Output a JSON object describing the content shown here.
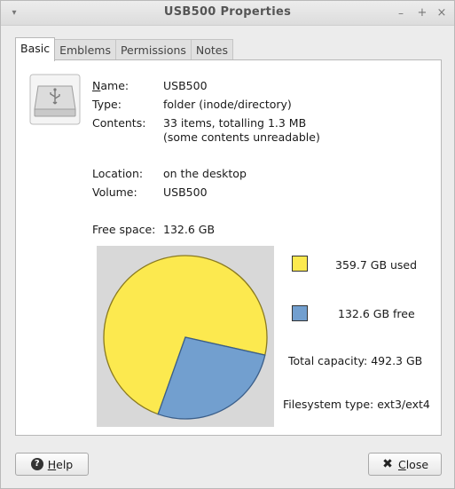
{
  "window": {
    "title": "USB500 Properties",
    "menu_icon": "chevron-down-icon",
    "minimize_glyph": "–",
    "maximize_glyph": "+",
    "close_glyph": "×"
  },
  "tabs": [
    {
      "label": "Basic",
      "active": true
    },
    {
      "label": "Emblems",
      "active": false
    },
    {
      "label": "Permissions",
      "active": false
    },
    {
      "label": "Notes",
      "active": false
    }
  ],
  "info": {
    "name_label": "Name:",
    "name_value": "USB500",
    "type_label": "Type:",
    "type_value": "folder (inode/directory)",
    "contents_label": "Contents:",
    "contents_value_line1": "33 items, totalling 1.3 MB",
    "contents_value_line2": "(some contents unreadable)",
    "location_label": "Location:",
    "location_value": "on the desktop",
    "volume_label": "Volume:",
    "volume_value": "USB500",
    "free_label": "Free space:",
    "free_value": "132.6 GB"
  },
  "usage": {
    "used_label": "359.7 GB used",
    "free_label": "132.6 GB free",
    "total_label": "Total capacity: 492.3 GB",
    "fs_label": "Filesystem type: ext3/ext4",
    "used_gb": 359.7,
    "free_gb": 132.6,
    "used_color": "#fce94f",
    "free_color": "#729fcf"
  },
  "buttons": {
    "help_label": "Help",
    "close_label": "Close"
  }
}
